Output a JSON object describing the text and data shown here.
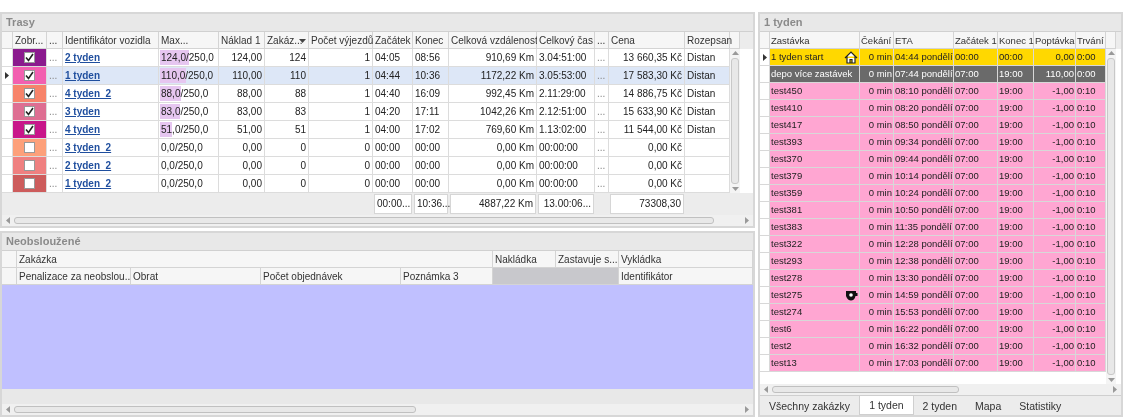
{
  "routes": {
    "title": "Trasy",
    "columns": [
      {
        "label": "Zobr...",
        "sorted": false
      },
      {
        "label": "...",
        "sorted": false
      },
      {
        "label": "Identifikátor vozidla",
        "sorted": false
      },
      {
        "label": "Max...",
        "sorted": false
      },
      {
        "label": "Náklad 1",
        "sorted": false
      },
      {
        "label": "Zakáz...",
        "sorted": true
      },
      {
        "label": "Počet výjezdů",
        "sorted": false
      },
      {
        "label": "Začátek",
        "sorted": false
      },
      {
        "label": "Konec",
        "sorted": false
      },
      {
        "label": "Celková vzdálenost",
        "sorted": false
      },
      {
        "label": "Celkový čas",
        "sorted": false
      },
      {
        "label": "...",
        "sorted": false
      },
      {
        "label": "Cena",
        "sorted": false
      },
      {
        "label": "Rozepsan",
        "sorted": false
      }
    ],
    "rows": [
      {
        "selected": false,
        "color": "#8b1a8e",
        "checked": true,
        "column_2": "...",
        "vehicle": "2 tyden",
        "max": "124,0/250,0",
        "level": 0.496,
        "load": "124,00",
        "orders": "124",
        "trips": "1",
        "start": "04:05",
        "end": "08:56",
        "distance": "910,69 Km",
        "time": "3.04:51:00",
        "column_12": "...",
        "price": "13 660,35 Kč",
        "breakdown": "Distan"
      },
      {
        "selected": true,
        "color": "#f25fb0",
        "checked": true,
        "column_2": "...",
        "vehicle": "1 tyden",
        "max": "110,0/250,0",
        "level": 0.44,
        "load": "110,00",
        "orders": "110",
        "trips": "1",
        "start": "04:44",
        "end": "10:36",
        "distance": "1172,22 Km",
        "time": "3.05:53:00",
        "column_12": "...",
        "price": "17 583,30 Kč",
        "breakdown": "Distan"
      },
      {
        "selected": false,
        "color": "#f7836a",
        "checked": true,
        "column_2": "...",
        "vehicle": "4 tyden_2",
        "max": "88,0/250,0",
        "level": 0.352,
        "load": "88,00",
        "orders": "88",
        "trips": "1",
        "start": "04:40",
        "end": "16:09",
        "distance": "992,45 Km",
        "time": "2.11:29:00",
        "column_12": "...",
        "price": "14 886,75 Kč",
        "breakdown": "Distan"
      },
      {
        "selected": false,
        "color": "#de6e92",
        "checked": true,
        "column_2": "...",
        "vehicle": "3 tyden",
        "max": "83,0/250,0",
        "level": 0.332,
        "load": "83,00",
        "orders": "83",
        "trips": "1",
        "start": "04:20",
        "end": "17:11",
        "distance": "1042,26 Km",
        "time": "2.12:51:00",
        "column_12": "...",
        "price": "15 633,90 Kč",
        "breakdown": "Distan"
      },
      {
        "selected": false,
        "color": "#c8168a",
        "checked": true,
        "column_2": "...",
        "vehicle": "4 tyden",
        "max": "51,0/250,0",
        "level": 0.204,
        "load": "51,00",
        "orders": "51",
        "trips": "1",
        "start": "04:00",
        "end": "17:02",
        "distance": "769,60 Km",
        "time": "1.13:02:00",
        "column_12": "...",
        "price": "11 544,00 Kč",
        "breakdown": "Distan"
      },
      {
        "selected": false,
        "color": "#fda07a",
        "checked": false,
        "column_2": "...",
        "vehicle": "3 tyden_2",
        "max": "0,0/250,0",
        "load": "0,00",
        "orders": "0",
        "trips": "0",
        "start": "00:00",
        "end": "00:00",
        "distance": "0,00 Km",
        "time": "00:00:00",
        "column_12": "...",
        "price": "0,00 Kč"
      },
      {
        "selected": false,
        "color": "#ef8080",
        "checked": false,
        "column_2": "...",
        "vehicle": "2 tyden_2",
        "max": "0,0/250,0",
        "load": "0,00",
        "orders": "0",
        "trips": "0",
        "start": "00:00",
        "end": "00:00",
        "distance": "0,00 Km",
        "time": "00:00:00",
        "column_12": "...",
        "price": "0,00 Kč"
      },
      {
        "selected": false,
        "color": "#cd5c5c",
        "checked": false,
        "column_2": "...",
        "vehicle": "1 tyden_2",
        "max": "0,0/250,0",
        "load": "0,00",
        "orders": "0",
        "trips": "0",
        "start": "00:00",
        "end": "00:00",
        "distance": "0,00 Km",
        "time": "00:00:00",
        "column_12": "...",
        "price": "0,00 Kč"
      }
    ],
    "totals": {
      "start": "00:00...",
      "end": "10:36...",
      "distance": "4887,22 Km",
      "time": "13.00:06...",
      "price": "73308,30"
    }
  },
  "unserved": {
    "title": "Neobsloužené",
    "header_top": [
      "Zakázka",
      "Nakládka",
      "Zastavuje s...",
      "Vykládka"
    ],
    "header_bottom": [
      "Penalizace za neobslou...",
      "Obrat",
      "Počet objednávek",
      "Poznámka 3",
      "Identifikátor"
    ]
  },
  "route_detail": {
    "title": "1 tyden",
    "columns": [
      "Zastávka",
      "Čekání",
      "ETA",
      "Začátek 1",
      "Konec 1",
      "Poptávka",
      "Trvání"
    ],
    "rows": [
      {
        "kind": "start",
        "selected": true,
        "stop": "1 tyden start",
        "wait": "0 min",
        "eta": "04:44 pondělí",
        "start": "00:00",
        "end": "00:00",
        "demand": "0,00",
        "duration": "0:00"
      },
      {
        "kind": "depot",
        "selected": false,
        "stop": "depo více zastávek",
        "wait": "0 min",
        "eta": "07:44 pondělí",
        "start": "07:00",
        "end": "19:00",
        "demand": "110,00",
        "duration": "0:00"
      },
      {
        "kind": "stop",
        "selected": false,
        "stop": "test450",
        "wait": "0 min",
        "eta": "08:10 pondělí",
        "start": "07:00",
        "end": "19:00",
        "demand": "-1,00",
        "duration": "0:10"
      },
      {
        "kind": "stop",
        "selected": false,
        "stop": "test410",
        "wait": "0 min",
        "eta": "08:20 pondělí",
        "start": "07:00",
        "end": "19:00",
        "demand": "-1,00",
        "duration": "0:10"
      },
      {
        "kind": "stop",
        "selected": false,
        "stop": "test417",
        "wait": "0 min",
        "eta": "08:50 pondělí",
        "start": "07:00",
        "end": "19:00",
        "demand": "-1,00",
        "duration": "0:10"
      },
      {
        "kind": "stop",
        "selected": false,
        "stop": "test393",
        "wait": "0 min",
        "eta": "09:34 pondělí",
        "start": "07:00",
        "end": "19:00",
        "demand": "-1,00",
        "duration": "0:10"
      },
      {
        "kind": "stop",
        "selected": false,
        "stop": "test370",
        "wait": "0 min",
        "eta": "09:44 pondělí",
        "start": "07:00",
        "end": "19:00",
        "demand": "-1,00",
        "duration": "0:10"
      },
      {
        "kind": "stop",
        "selected": false,
        "stop": "test379",
        "wait": "0 min",
        "eta": "10:14 pondělí",
        "start": "07:00",
        "end": "19:00",
        "demand": "-1,00",
        "duration": "0:10"
      },
      {
        "kind": "stop",
        "selected": false,
        "stop": "test359",
        "wait": "0 min",
        "eta": "10:24 pondělí",
        "start": "07:00",
        "end": "19:00",
        "demand": "-1,00",
        "duration": "0:10"
      },
      {
        "kind": "stop",
        "selected": false,
        "stop": "test381",
        "wait": "0 min",
        "eta": "10:50 pondělí",
        "start": "07:00",
        "end": "19:00",
        "demand": "-1,00",
        "duration": "0:10"
      },
      {
        "kind": "stop",
        "selected": false,
        "stop": "test383",
        "wait": "0 min",
        "eta": "11:35 pondělí",
        "start": "07:00",
        "end": "19:00",
        "demand": "-1,00",
        "duration": "0:10"
      },
      {
        "kind": "stop",
        "selected": false,
        "stop": "test322",
        "wait": "0 min",
        "eta": "12:28 pondělí",
        "start": "07:00",
        "end": "19:00",
        "demand": "-1,00",
        "duration": "0:10"
      },
      {
        "kind": "stop",
        "selected": false,
        "stop": "test293",
        "wait": "0 min",
        "eta": "12:38 pondělí",
        "start": "07:00",
        "end": "19:00",
        "demand": "-1,00",
        "duration": "0:10"
      },
      {
        "kind": "stop",
        "selected": false,
        "stop": "test278",
        "wait": "0 min",
        "eta": "13:30 pondělí",
        "start": "07:00",
        "end": "19:00",
        "demand": "-1,00",
        "duration": "0:10"
      },
      {
        "kind": "break",
        "selected": false,
        "stop": "test275",
        "wait": "0 min",
        "eta": "14:59 pondělí",
        "start": "07:00",
        "end": "19:00",
        "demand": "-1,00",
        "duration": "0:10"
      },
      {
        "kind": "stop",
        "selected": false,
        "stop": "test274",
        "wait": "0 min",
        "eta": "15:53 pondělí",
        "start": "07:00",
        "end": "19:00",
        "demand": "-1,00",
        "duration": "0:10"
      },
      {
        "kind": "stop",
        "selected": false,
        "stop": "test6",
        "wait": "0 min",
        "eta": "16:22 pondělí",
        "start": "07:00",
        "end": "19:00",
        "demand": "-1,00",
        "duration": "0:10"
      },
      {
        "kind": "stop",
        "selected": false,
        "stop": "test2",
        "wait": "0 min",
        "eta": "16:32 pondělí",
        "start": "07:00",
        "end": "19:00",
        "demand": "-1,00",
        "duration": "0:10"
      },
      {
        "kind": "stop",
        "selected": false,
        "stop": "test13",
        "wait": "0 min",
        "eta": "17:03 pondělí",
        "start": "07:00",
        "end": "19:00",
        "demand": "-1,00",
        "duration": "0:10"
      }
    ]
  },
  "tabs": [
    {
      "label": "Všechny zakázky",
      "selected": false
    },
    {
      "label": "1 tyden",
      "selected": true
    },
    {
      "label": "2 tyden",
      "selected": false
    },
    {
      "label": "Mapa",
      "selected": false
    },
    {
      "label": "Statistiky",
      "selected": false
    }
  ]
}
